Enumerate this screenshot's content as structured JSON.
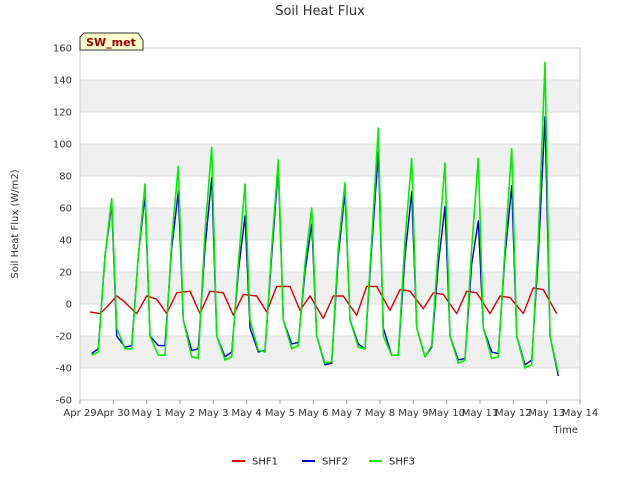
{
  "chart_data": {
    "type": "line",
    "title": "Soil Heat Flux",
    "xlabel": "Time",
    "ylabel": "Soil Heat Flux (W/m2)",
    "badge": "SW_met",
    "xlim": [
      0,
      15
    ],
    "ylim": [
      -60,
      160
    ],
    "x_tick_labels": [
      "Apr 29",
      "Apr 30",
      "May 1",
      "May 2",
      "May 3",
      "May 4",
      "May 5",
      "May 6",
      "May 7",
      "May 8",
      "May 9",
      "May 10",
      "May 11",
      "May 12",
      "May 13",
      "May 14"
    ],
    "y_ticks": [
      -60,
      -40,
      -20,
      0,
      20,
      40,
      60,
      80,
      100,
      120,
      140,
      160
    ],
    "legend_position": "bottom",
    "colors": {
      "SHF1": "#dd0000",
      "SHF2": "#0000cc",
      "SHF3": "#00ee00",
      "band": "#f0f0f0",
      "grid": "#dddddd"
    },
    "x_units": "days since Apr 29",
    "series": [
      {
        "name": "SHF1",
        "x": [
          0.3,
          0.6,
          0.8,
          1.1,
          1.3,
          1.7,
          2.0,
          2.3,
          2.6,
          2.9,
          3.3,
          3.6,
          3.9,
          4.3,
          4.6,
          4.9,
          5.3,
          5.6,
          5.9,
          6.3,
          6.6,
          6.9,
          7.3,
          7.6,
          7.9,
          8.3,
          8.6,
          8.9,
          9.3,
          9.6,
          9.9,
          10.3,
          10.6,
          10.9,
          11.3,
          11.6,
          11.9,
          12.3,
          12.6,
          12.9,
          13.3,
          13.6,
          13.9,
          14.3
        ],
        "y": [
          -5,
          -6,
          -2,
          5,
          2,
          -6,
          5,
          3,
          -6,
          7,
          8,
          -6,
          8,
          7,
          -7,
          6,
          5,
          -5,
          11,
          11,
          -4,
          5,
          -9,
          5,
          5,
          -7,
          11,
          11,
          -4,
          9,
          8,
          -3,
          7,
          6,
          -6,
          8,
          7,
          -6,
          5,
          4,
          -6,
          10,
          9,
          -6
        ]
      },
      {
        "name": "SHF2",
        "x": [
          0.35,
          0.55,
          0.75,
          0.95,
          1.1,
          1.35,
          1.55,
          1.75,
          1.95,
          2.1,
          2.35,
          2.55,
          2.75,
          2.95,
          3.1,
          3.35,
          3.55,
          3.75,
          3.95,
          4.1,
          4.35,
          4.55,
          4.75,
          4.95,
          5.1,
          5.35,
          5.55,
          5.75,
          5.95,
          6.1,
          6.35,
          6.55,
          6.75,
          6.95,
          7.1,
          7.35,
          7.55,
          7.75,
          7.95,
          8.1,
          8.35,
          8.55,
          8.75,
          8.95,
          9.1,
          9.35,
          9.55,
          9.75,
          9.95,
          10.1,
          10.35,
          10.55,
          10.75,
          10.95,
          11.1,
          11.35,
          11.55,
          11.75,
          11.95,
          12.1,
          12.35,
          12.55,
          12.75,
          12.95,
          13.1,
          13.35,
          13.55,
          13.75,
          13.95,
          14.1,
          14.35
        ],
        "y": [
          -31,
          -28,
          30,
          62,
          -20,
          -27,
          -26,
          30,
          68,
          -20,
          -26,
          -26,
          35,
          70,
          -10,
          -29,
          -28,
          35,
          79,
          -20,
          -33,
          -30,
          20,
          55,
          -15,
          -30,
          -29,
          30,
          85,
          -10,
          -25,
          -24,
          20,
          50,
          -20,
          -38,
          -37,
          30,
          70,
          -10,
          -25,
          -28,
          35,
          95,
          -15,
          -32,
          -32,
          30,
          70,
          -15,
          -33,
          -27,
          25,
          61,
          -20,
          -35,
          -34,
          25,
          52,
          -15,
          -30,
          -31,
          30,
          74,
          -20,
          -38,
          -35,
          30,
          117,
          -20,
          -45
        ]
      },
      {
        "name": "SHF3",
        "x": [
          0.35,
          0.55,
          0.75,
          0.95,
          1.1,
          1.35,
          1.55,
          1.75,
          1.95,
          2.1,
          2.35,
          2.55,
          2.75,
          2.95,
          3.1,
          3.35,
          3.55,
          3.75,
          3.95,
          4.1,
          4.35,
          4.55,
          4.75,
          4.95,
          5.1,
          5.35,
          5.55,
          5.75,
          5.95,
          6.1,
          6.35,
          6.55,
          6.75,
          6.95,
          7.1,
          7.35,
          7.55,
          7.75,
          7.95,
          8.1,
          8.35,
          8.55,
          8.75,
          8.95,
          9.1,
          9.35,
          9.55,
          9.75,
          9.95,
          10.1,
          10.35,
          10.55,
          10.75,
          10.95,
          11.1,
          11.35,
          11.55,
          11.75,
          11.95,
          12.1,
          12.35,
          12.55,
          12.75,
          12.95,
          13.1,
          13.35,
          13.55,
          13.75,
          13.95,
          14.1,
          14.35
        ],
        "y": [
          -32,
          -30,
          30,
          66,
          -15,
          -28,
          -28,
          30,
          75,
          -20,
          -32,
          -32,
          40,
          86,
          -10,
          -33,
          -34,
          45,
          98,
          -20,
          -35,
          -33,
          25,
          75,
          -10,
          -29,
          -30,
          35,
          90,
          -10,
          -28,
          -26,
          25,
          60,
          -20,
          -37,
          -36,
          35,
          76,
          -10,
          -27,
          -28,
          40,
          110,
          -20,
          -32,
          -32,
          40,
          91,
          -15,
          -33,
          -26,
          35,
          88,
          -20,
          -37,
          -35,
          35,
          91,
          -15,
          -34,
          -33,
          35,
          97,
          -20,
          -40,
          -38,
          40,
          151,
          -20,
          -43
        ]
      }
    ]
  }
}
